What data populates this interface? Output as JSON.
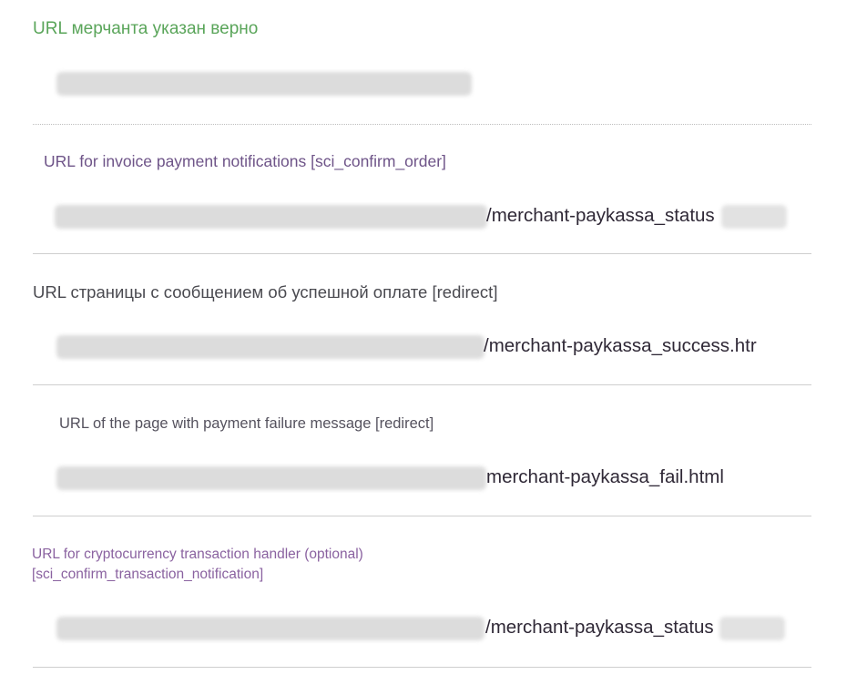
{
  "status": {
    "text": "URL мерчанта указан верно"
  },
  "fields": [
    {
      "label": "URL for invoice payment notifications [sci_confirm_order]",
      "path": "/merchant-paykassa_status"
    },
    {
      "label": "URL страницы с сообщением об успешной оплате [redirect]",
      "path": "/merchant-paykassa_success.htr"
    },
    {
      "label": "URL of the page with payment failure message [redirect]",
      "path": "merchant-paykassa_fail.html"
    },
    {
      "label_line1": "URL for cryptocurrency transaction handler (optional)",
      "label_line2": "[sci_confirm_transaction_notification]",
      "path": "/merchant-paykassa_status"
    }
  ],
  "colors": {
    "status_ok": "#5aa55a",
    "label_purple": "#6e5488",
    "path_text": "#2f2836"
  }
}
